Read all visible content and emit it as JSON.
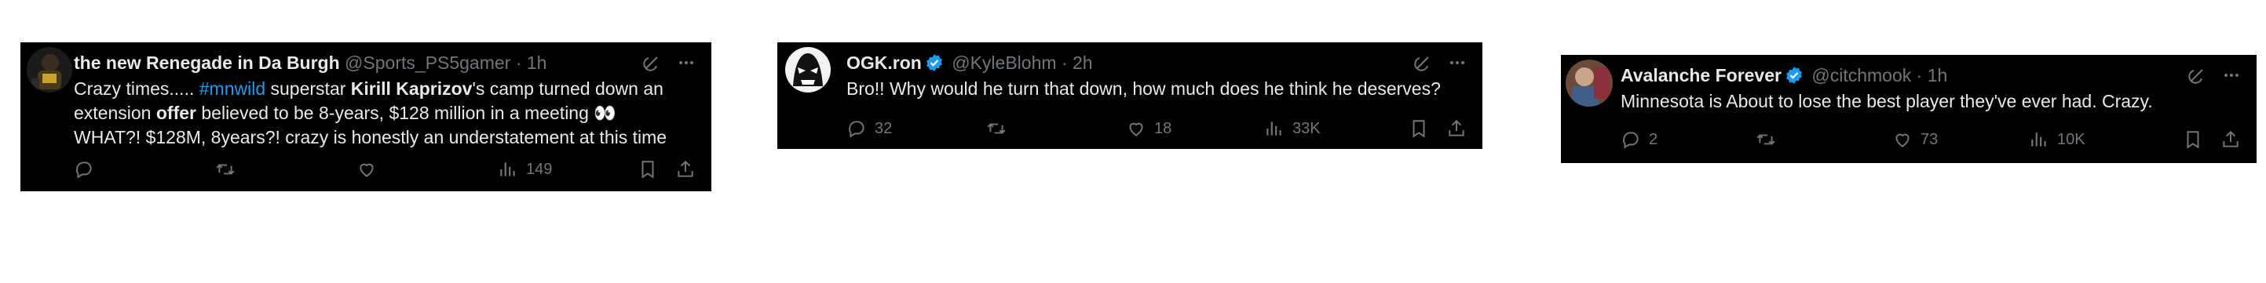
{
  "tweets": [
    {
      "name": "the new Renegade in Da Burgh",
      "handle": "@Sports_PS5gamer",
      "dot": "·",
      "time": "1h",
      "verified": false,
      "text_parts": {
        "p1": "Crazy times..... ",
        "hashtag": "#mnwild",
        "p2": " superstar ",
        "bold1": "Kirill Kaprizov",
        "p3": "'s camp turned down an extension ",
        "bold2": "offer",
        "p4": " believed to be 8-years, $128 million in a meeting 👀\nWHAT?! $128M, 8years?! crazy is honestly an understatement at this time"
      },
      "stats": {
        "replies": "",
        "retweets": "",
        "likes": "",
        "views": "149"
      }
    },
    {
      "name": "OGK.ron",
      "handle": "@KyleBlohm",
      "dot": "·",
      "time": "2h",
      "verified": true,
      "text": "Bro!! Why would he turn that down, how much does he think he deserves?",
      "stats": {
        "replies": "32",
        "retweets": "",
        "likes": "18",
        "views": "33K"
      }
    },
    {
      "name": "Avalanche Forever",
      "handle": "@citchmook",
      "dot": "·",
      "time": "1h",
      "verified": true,
      "text": "Minnesota is About to lose the best player they've ever had. Crazy.",
      "stats": {
        "replies": "2",
        "retweets": "",
        "likes": "73",
        "views": "10K"
      }
    }
  ],
  "colors": {
    "background": "#000000",
    "text": "#e7e9ea",
    "muted": "#71767b",
    "link": "#1d9bf0",
    "verified": "#1d9bf0"
  },
  "icons": [
    "grok-icon",
    "more-icon",
    "reply-icon",
    "retweet-icon",
    "like-icon",
    "views-icon",
    "bookmark-icon",
    "share-icon",
    "verified-badge-icon"
  ]
}
